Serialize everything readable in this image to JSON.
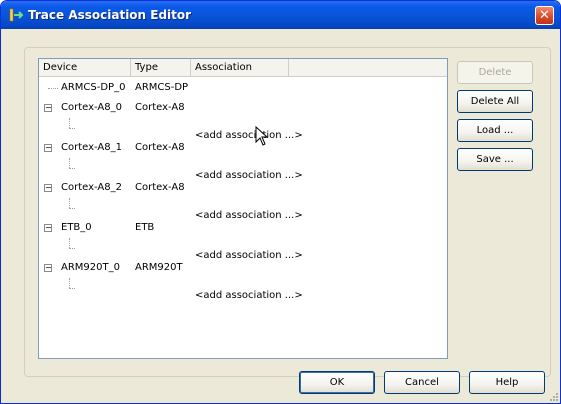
{
  "window": {
    "title": "Trace Association Editor",
    "close_glyph": "✕",
    "title_icon": "trace-association-app-icon"
  },
  "table": {
    "columns": [
      "Device",
      "Type",
      "Association",
      ""
    ],
    "rows": [
      {
        "device": "ARMCS-DP_0",
        "type": "ARMCS-DP",
        "expander": "",
        "association": ""
      },
      {
        "device": "Cortex-A8_0",
        "type": "Cortex-A8",
        "expander": "−",
        "association": ""
      },
      {
        "device": "",
        "type": "",
        "expander": "",
        "association": "<add association ...>"
      },
      {
        "device": "Cortex-A8_1",
        "type": "Cortex-A8",
        "expander": "−",
        "association": ""
      },
      {
        "device": "",
        "type": "",
        "expander": "",
        "association": "<add association ...>"
      },
      {
        "device": "Cortex-A8_2",
        "type": "Cortex-A8",
        "expander": "−",
        "association": ""
      },
      {
        "device": "",
        "type": "",
        "expander": "",
        "association": "<add association ...>"
      },
      {
        "device": "ETB_0",
        "type": "ETB",
        "expander": "−",
        "association": ""
      },
      {
        "device": "",
        "type": "",
        "expander": "",
        "association": "<add association ...>"
      },
      {
        "device": "ARM920T_0",
        "type": "ARM920T",
        "expander": "−",
        "association": ""
      },
      {
        "device": "",
        "type": "",
        "expander": "",
        "association": "<add association ...>"
      }
    ]
  },
  "side_buttons": {
    "delete": "Delete",
    "delete_all": "Delete All",
    "load": "Load ...",
    "save": "Save ..."
  },
  "footer_buttons": {
    "ok": "OK",
    "cancel": "Cancel",
    "help": "Help"
  },
  "colors": {
    "titlebar": "#0a5ae8",
    "dialog_bg": "#ece9d8",
    "button_border": "#003c74"
  }
}
